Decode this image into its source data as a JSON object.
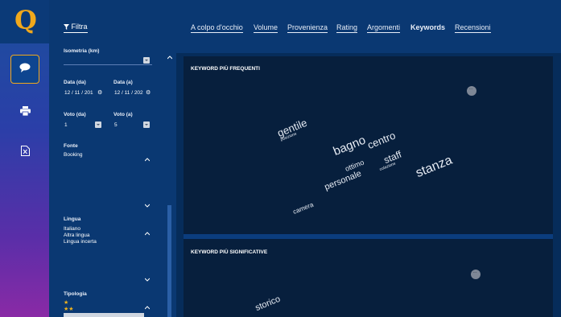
{
  "rail": {
    "logo_letter": "Q",
    "items": [
      {
        "icon": "chat-bubble-icon"
      },
      {
        "icon": "print-icon"
      },
      {
        "icon": "excel-file-icon"
      }
    ],
    "accent_color": "#f0a81c"
  },
  "filters": {
    "title": "Filtra",
    "title_icon": "funnel-icon",
    "isometria_label": "Isometria (km)",
    "data_da_label": "Data (da)",
    "data_da_value": "12 / 11 / 201",
    "data_a_label": "Data (a)",
    "data_a_value": "12 / 11 / 202",
    "voto_da_label": "Voto (da)",
    "voto_da_value": "1",
    "voto_a_label": "Voto (a)",
    "voto_a_value": "5",
    "fonte_label": "Fonte",
    "fonte_items": [
      "Booking"
    ],
    "lingua_label": "Lingua",
    "lingua_items": [
      "Italiano",
      "Altra lingua",
      "Lingua incerta"
    ],
    "tipologia_label": "Tipologia",
    "tipologia_items": [
      "★",
      "★★"
    ]
  },
  "tabs": [
    {
      "label": "A colpo d'occhio",
      "active": false
    },
    {
      "label": "Volume",
      "active": false
    },
    {
      "label": "Provenienza",
      "active": false
    },
    {
      "label": "Rating",
      "active": false
    },
    {
      "label": "Argomenti",
      "active": false
    },
    {
      "label": "Keywords",
      "active": true
    },
    {
      "label": "Recensioni",
      "active": false
    }
  ],
  "card_frequent": {
    "title": "KEYWORD PIÙ FREQUENTI",
    "words": [
      "gentile",
      "posizione",
      "bagno",
      "centro",
      "ottimo",
      "staff",
      "colazione",
      "stanza",
      "personale",
      "camera"
    ]
  },
  "card_significant": {
    "title": "KEYWORD PIÙ SIGNIFICATIVE",
    "words": [
      "storico"
    ]
  }
}
